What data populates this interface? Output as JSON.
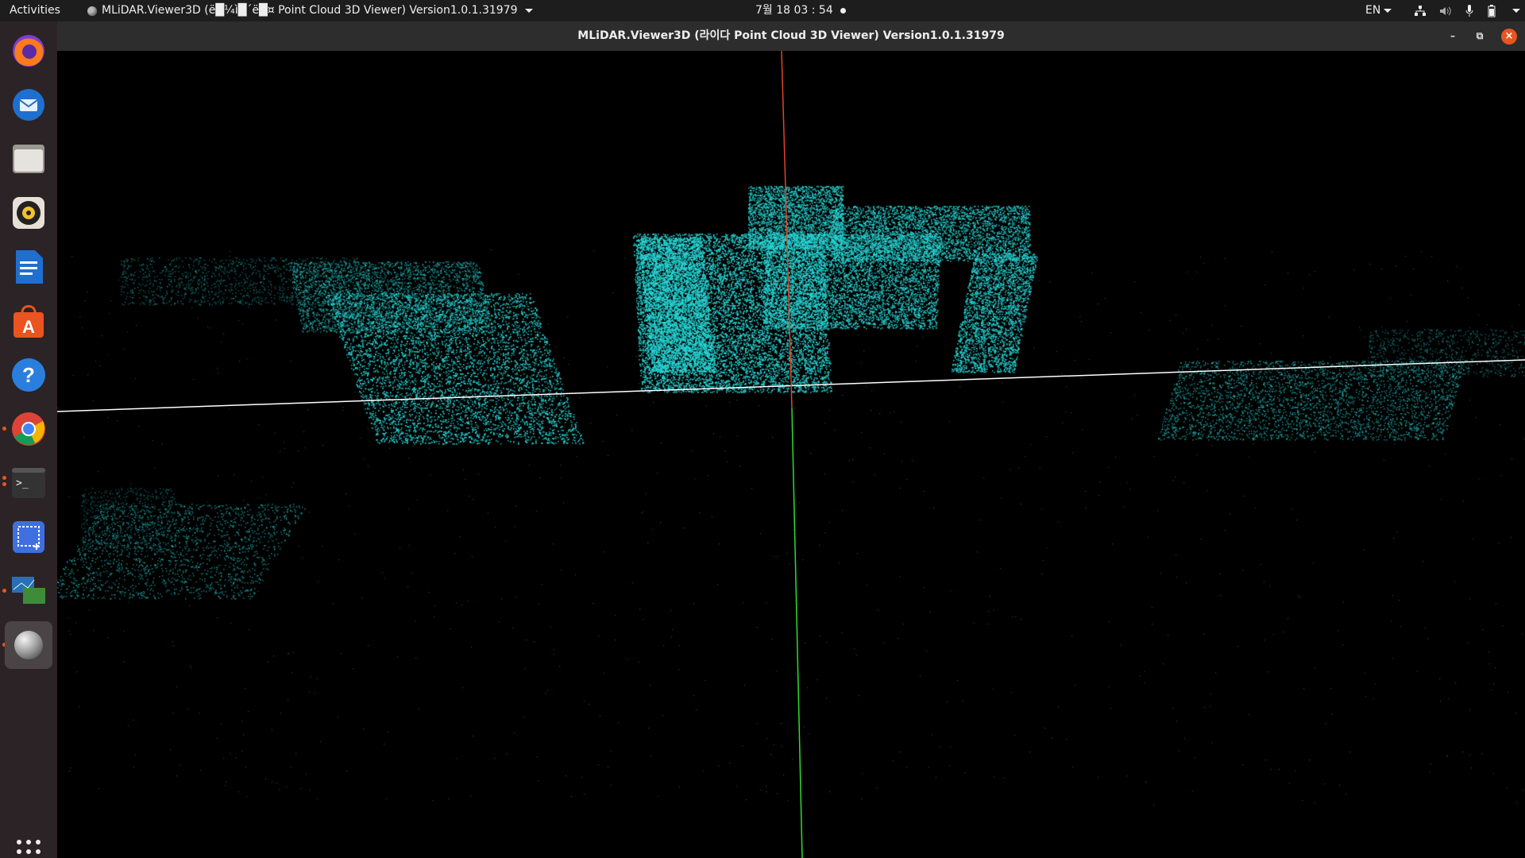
{
  "topbar": {
    "activities": "Activities",
    "app_menu_title": "MLiDAR.Viewer3D (ë█¼ì█´ë█¤ Point Cloud 3D Viewer) Version1.0.1.31979",
    "clock": "7월 18  03 : 54",
    "language": "EN",
    "tray_icons": [
      "network-icon",
      "volume-icon",
      "microphone-icon",
      "battery-icon",
      "system-menu-chevron"
    ]
  },
  "dock": {
    "items": [
      {
        "name": "firefox",
        "running": false
      },
      {
        "name": "thunderbird",
        "running": false
      },
      {
        "name": "files",
        "running": false
      },
      {
        "name": "rhythmbox",
        "running": false
      },
      {
        "name": "libreoffice-writer",
        "running": false
      },
      {
        "name": "ubuntu-software",
        "running": false
      },
      {
        "name": "help",
        "running": false
      },
      {
        "name": "chrome",
        "running": true
      },
      {
        "name": "terminal",
        "running": true
      },
      {
        "name": "screenshot",
        "running": false
      },
      {
        "name": "remote-desktop",
        "running": true
      },
      {
        "name": "mlidar-viewer",
        "running": true,
        "active": true
      }
    ],
    "show_apps": "show-applications-icon"
  },
  "window": {
    "title": "MLiDAR.Viewer3D (라이다 Point Cloud 3D Viewer) Version1.0.1.31979",
    "controls": [
      "minimize",
      "restore",
      "close"
    ]
  },
  "viewport": {
    "background": "#000000",
    "point_color": "#27d6d6",
    "axes": {
      "x": "#ffffff",
      "y_upper": "#e0452a",
      "y_lower": "#2fdc2f"
    }
  }
}
